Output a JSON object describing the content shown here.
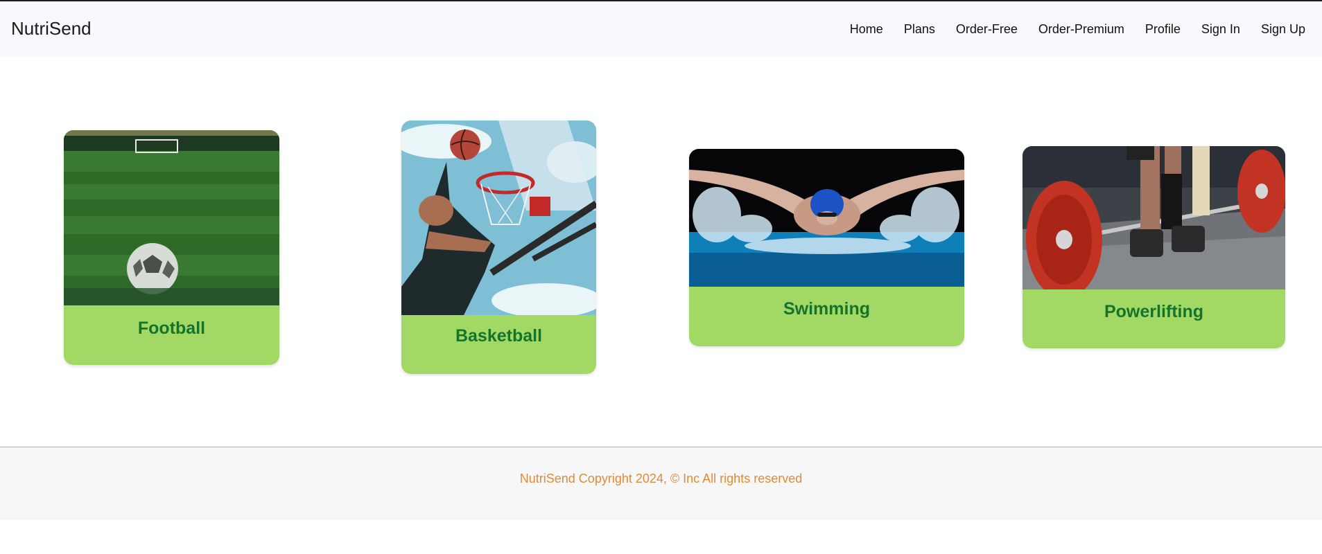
{
  "brand": "NutriSend",
  "nav": {
    "items": [
      "Home",
      "Plans",
      "Order-Free",
      "Order-Premium",
      "Profile",
      "Sign In",
      "Sign Up"
    ]
  },
  "cards": [
    {
      "label": "Football",
      "image": "football-field-with-ball"
    },
    {
      "label": "Basketball",
      "image": "player-dunking-basketball"
    },
    {
      "label": "Swimming",
      "image": "swimmer-butterfly-stroke"
    },
    {
      "label": "Powerlifting",
      "image": "barbell-deadlift"
    }
  ],
  "colors": {
    "card_bg": "#a2d964",
    "card_text": "#14742e",
    "footer_text": "#e08a37",
    "navbar_bg": "#f8f8fd"
  },
  "footer": {
    "text": "NutriSend Copyright 2024, © Inc All rights reserved"
  }
}
